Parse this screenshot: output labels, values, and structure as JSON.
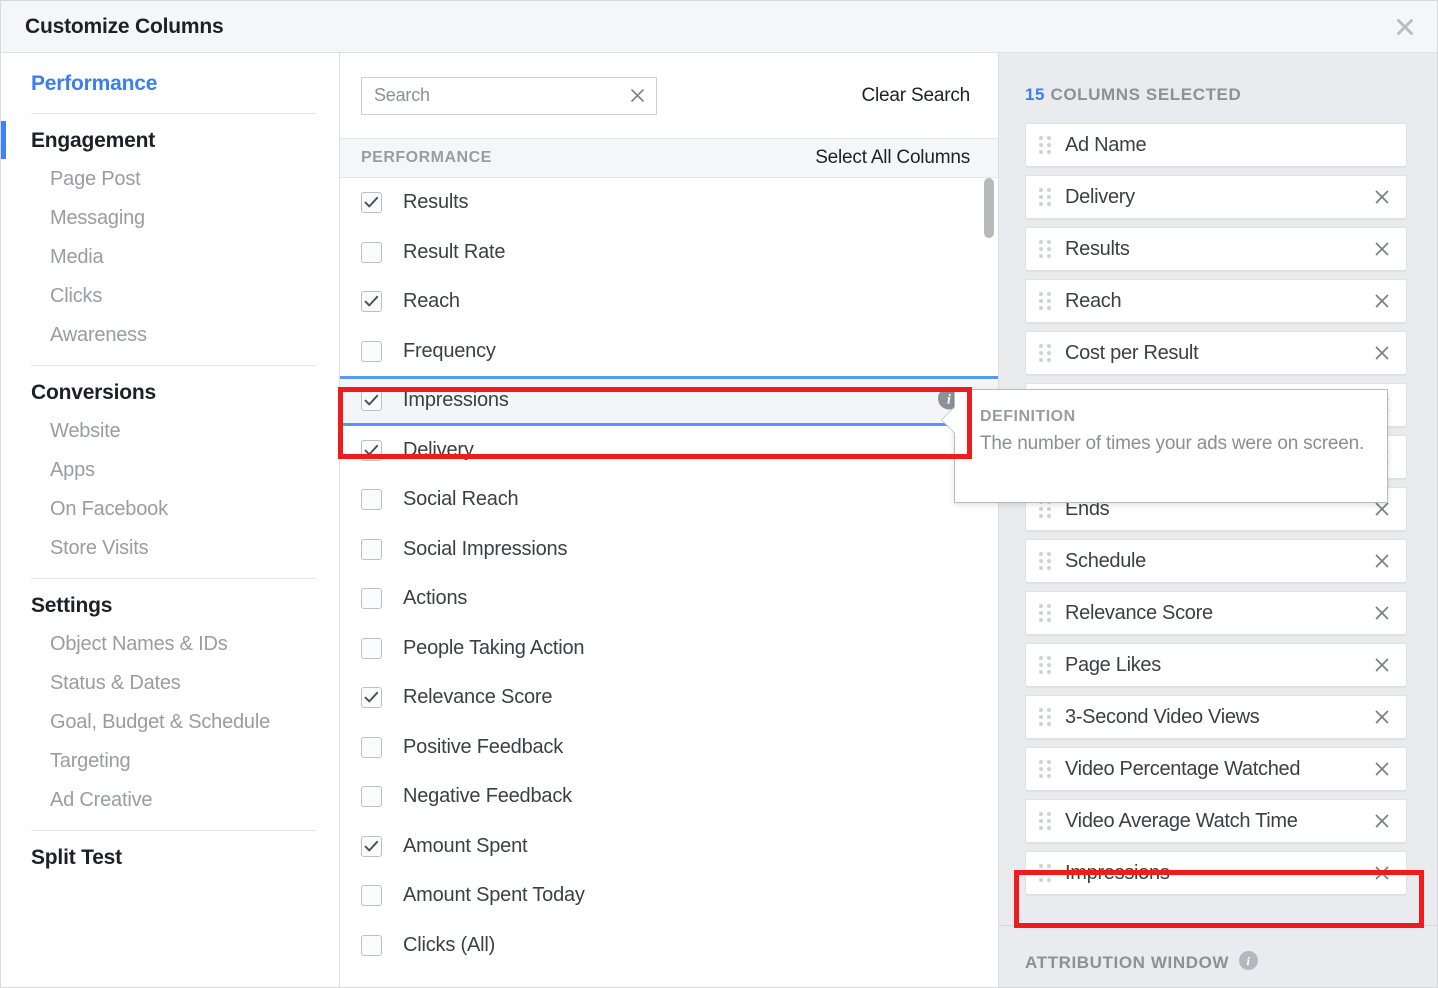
{
  "window": {
    "title": "Customize Columns",
    "close_icon": "close-icon"
  },
  "sidebar": {
    "groups": [
      {
        "heading": "Performance",
        "active": true,
        "items": []
      },
      {
        "heading": "Engagement",
        "active": false,
        "items": [
          "Page Post",
          "Messaging",
          "Media",
          "Clicks",
          "Awareness"
        ]
      },
      {
        "heading": "Conversions",
        "active": false,
        "items": [
          "Website",
          "Apps",
          "On Facebook",
          "Store Visits"
        ]
      },
      {
        "heading": "Settings",
        "active": false,
        "items": [
          "Object Names & IDs",
          "Status & Dates",
          "Goal, Budget & Schedule",
          "Targeting",
          "Ad Creative"
        ]
      },
      {
        "heading": "Split Test",
        "active": false,
        "items": []
      }
    ]
  },
  "search": {
    "placeholder": "Search",
    "value": "",
    "clear_icon": "close-icon",
    "clear_label": "Clear Search"
  },
  "list_header": {
    "section_label": "PERFORMANCE",
    "select_all_label": "Select All Columns"
  },
  "columns": [
    {
      "label": "Results",
      "checked": true,
      "highlight": false,
      "info": false
    },
    {
      "label": "Result Rate",
      "checked": false,
      "highlight": false,
      "info": false
    },
    {
      "label": "Reach",
      "checked": true,
      "highlight": false,
      "info": false
    },
    {
      "label": "Frequency",
      "checked": false,
      "highlight": false,
      "info": false
    },
    {
      "label": "Impressions",
      "checked": true,
      "highlight": true,
      "info": true
    },
    {
      "label": "Delivery",
      "checked": true,
      "highlight": false,
      "info": false
    },
    {
      "label": "Social Reach",
      "checked": false,
      "highlight": false,
      "info": false
    },
    {
      "label": "Social Impressions",
      "checked": false,
      "highlight": false,
      "info": false
    },
    {
      "label": "Actions",
      "checked": false,
      "highlight": false,
      "info": false
    },
    {
      "label": "People Taking Action",
      "checked": false,
      "highlight": false,
      "info": false
    },
    {
      "label": "Relevance Score",
      "checked": true,
      "highlight": false,
      "info": false
    },
    {
      "label": "Positive Feedback",
      "checked": false,
      "highlight": false,
      "info": false
    },
    {
      "label": "Negative Feedback",
      "checked": false,
      "highlight": false,
      "info": false
    },
    {
      "label": "Amount Spent",
      "checked": true,
      "highlight": false,
      "info": false
    },
    {
      "label": "Amount Spent Today",
      "checked": false,
      "highlight": false,
      "info": false
    },
    {
      "label": "Clicks (All)",
      "checked": false,
      "highlight": false,
      "info": false
    }
  ],
  "selected_panel": {
    "count": "15",
    "count_suffix": "COLUMNS SELECTED",
    "items": [
      {
        "label": "Ad Name",
        "removable": false,
        "highlight": false
      },
      {
        "label": "Delivery",
        "removable": true,
        "highlight": false
      },
      {
        "label": "Results",
        "removable": true,
        "highlight": false
      },
      {
        "label": "Reach",
        "removable": true,
        "highlight": false
      },
      {
        "label": "Cost per Result",
        "removable": true,
        "highlight": false
      },
      {
        "label": "",
        "removable": true,
        "highlight": false
      },
      {
        "label": "",
        "removable": true,
        "highlight": false
      },
      {
        "label": "Ends",
        "removable": true,
        "highlight": false
      },
      {
        "label": "Schedule",
        "removable": true,
        "highlight": false
      },
      {
        "label": "Relevance Score",
        "removable": true,
        "highlight": false
      },
      {
        "label": "Page Likes",
        "removable": true,
        "highlight": false
      },
      {
        "label": "3-Second Video Views",
        "removable": true,
        "highlight": false
      },
      {
        "label": "Video Percentage Watched",
        "removable": true,
        "highlight": false
      },
      {
        "label": "Video Average Watch Time",
        "removable": true,
        "highlight": false
      },
      {
        "label": "Impressions",
        "removable": true,
        "highlight": true
      }
    ],
    "attribution_label": "ATTRIBUTION WINDOW",
    "attribution_info_icon": "info-icon"
  },
  "tooltip": {
    "title": "DEFINITION",
    "text": "The number of times your ads were on screen."
  },
  "colors": {
    "accent_blue": "#3b7eec",
    "highlight_border": "#5699f5",
    "annotation_red": "#ee1c1c",
    "panel_bg": "#e9ebee"
  }
}
